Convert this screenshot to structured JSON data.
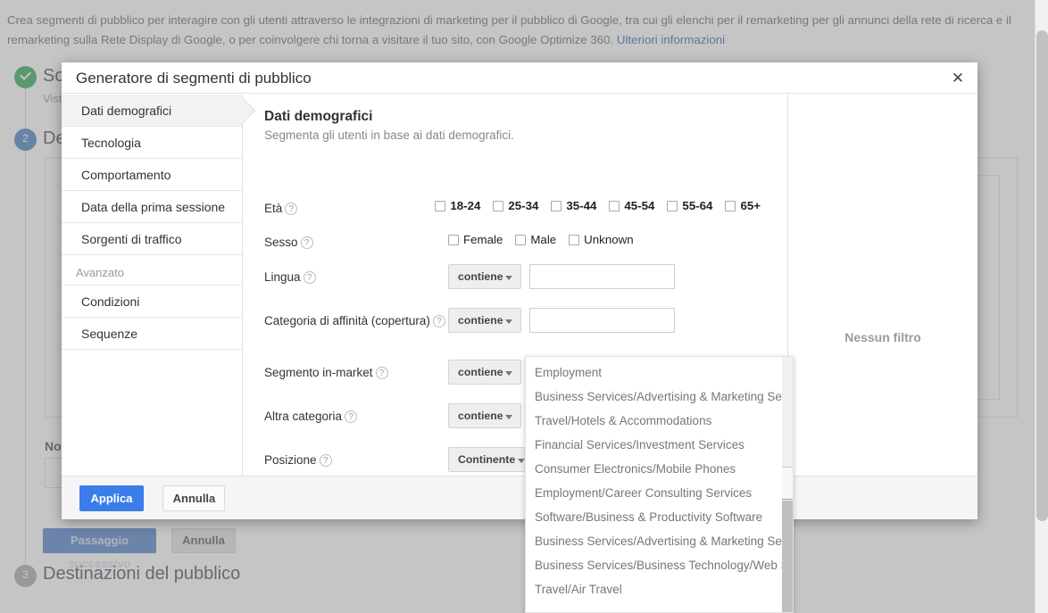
{
  "banner": {
    "text": "Crea segmenti di pubblico per interagire con gli utenti attraverso le integrazioni di marketing per il pubblico di Google, tra cui gli elenchi per il remarketing per gli annunci della rete di ricerca e il remarketing sulla Rete Display di Google, o per coinvolgere chi torna a visitare il tuo sito, con Google Optimize 360. ",
    "link": "Ulteriori informazioni"
  },
  "page": {
    "step1_badge": "",
    "step1_title": "So",
    "step1_sub": "Vist",
    "step2_badge": "2",
    "step2_title": "De",
    "step3_badge": "3",
    "step3_title": "Destinazioni del pubblico",
    "field_label": "Nor",
    "next_button": "Passaggio successivo",
    "cancel_button": "Annulla"
  },
  "dialog": {
    "title": "Generatore di segmenti di pubblico",
    "close_icon": "✕",
    "nav": {
      "items": [
        {
          "label": "Dati demografici",
          "active": true
        },
        {
          "label": "Tecnologia",
          "active": false
        },
        {
          "label": "Comportamento",
          "active": false
        },
        {
          "label": "Data della prima sessione",
          "active": false
        },
        {
          "label": "Sorgenti di traffico",
          "active": false
        }
      ],
      "group_label": "Avanzato",
      "advanced_items": [
        {
          "label": "Condizioni"
        },
        {
          "label": "Sequenze"
        }
      ]
    },
    "section": {
      "title": "Dati demografici",
      "subtitle": "Segmenta gli utenti in base ai dati demografici."
    },
    "help_icon": "?",
    "rows": {
      "age": {
        "label": "Età",
        "options": [
          "18-24",
          "25-34",
          "35-44",
          "45-54",
          "55-64",
          "65+"
        ]
      },
      "gender": {
        "label": "Sesso",
        "options": [
          "Female",
          "Male",
          "Unknown"
        ]
      },
      "language": {
        "label": "Lingua",
        "operator": "contiene",
        "value": ""
      },
      "affinity": {
        "label": "Categoria di affinità (copertura)",
        "operator": "contiene",
        "value": ""
      },
      "inmarket": {
        "label": "Segmento in-market",
        "operator": "contiene",
        "value": ""
      },
      "other_category": {
        "label": "Altra categoria",
        "operator": "contiene",
        "value": ""
      },
      "position": {
        "label": "Posizione",
        "operator": "Continente"
      }
    },
    "preview": {
      "empty_text": "Nessun filtro"
    },
    "footer": {
      "apply": "Applica",
      "cancel": "Annulla"
    }
  },
  "autocomplete": {
    "options": [
      "Employment",
      "Business Services/Advertising & Marketing Services",
      "Travel/Hotels & Accommodations",
      "Financial Services/Investment Services",
      "Consumer Electronics/Mobile Phones",
      "Employment/Career Consulting Services",
      "Software/Business & Productivity Software",
      "Business Services/Advertising & Marketing Services",
      "Business Services/Business Technology/Web Services",
      "Travel/Air Travel"
    ]
  },
  "colors": {
    "accent": "#3b7de9",
    "link": "#15539e",
    "success": "#139b48",
    "step_current": "#2f6fbc"
  }
}
